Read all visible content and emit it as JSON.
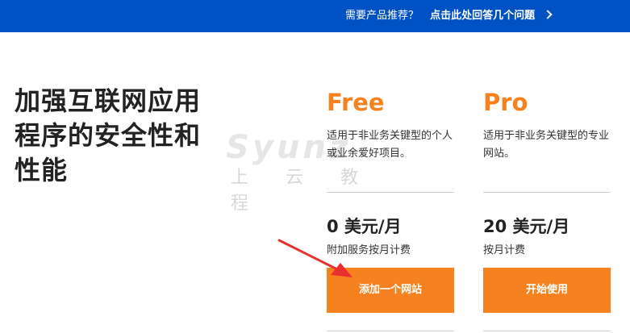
{
  "banner": {
    "question": "需要产品推荐？",
    "link_label": "点击此处回答几个问题",
    "chevron_icon": "chevron-right-icon",
    "background": "#0051c3"
  },
  "headline": {
    "text": "加强互联网应用程序的安全性和性能"
  },
  "watermark": {
    "brand": "Syunz",
    "sub": "上云教程"
  },
  "plans": [
    {
      "name": "Free",
      "description": "适用于非业务关键型的个人或业余爱好项目。",
      "price": "0 美元/月",
      "billing": "附加服务按月计费",
      "cta_label": "添加一个网站"
    },
    {
      "name": "Pro",
      "description": "适用于非业务关键型的专业网站。",
      "price": "20 美元/月",
      "billing": "按月计费",
      "cta_label": "开始使用"
    }
  ],
  "colors": {
    "accent": "#f6821f",
    "annotation_arrow": "#e8312f"
  }
}
